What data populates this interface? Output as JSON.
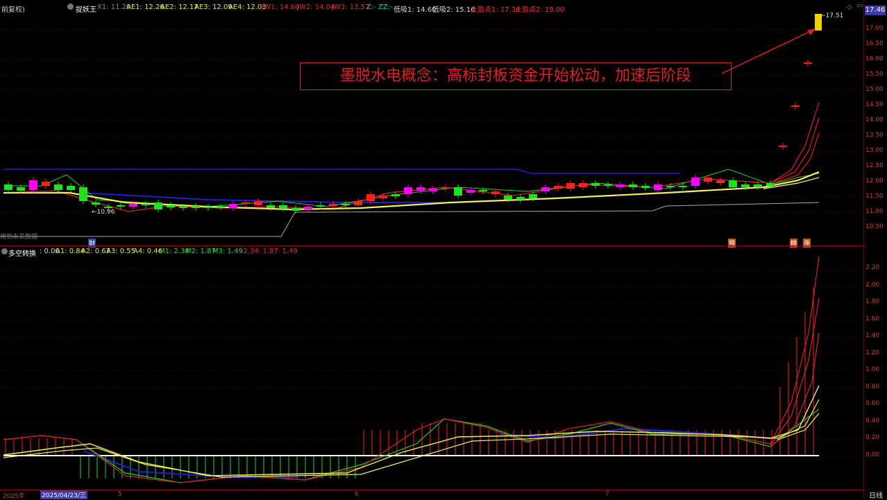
{
  "header": {
    "adjust_label": "前复权)",
    "indicator_name": "捉妖王",
    "x1": "X1: 11.29",
    "ae1": "AE1: 12.26",
    "ae2": "AE2: 12.17",
    "ae3": "AE3: 12.09",
    "ae4": "AE4: 12.03",
    "jw1": "JW1: 14.60",
    "jw2": "JW2: 14.04",
    "jw3": "JW3: 13.57",
    "zz": "Z:- ZZ:-",
    "dx1": "低吸1: 14.60",
    "dx2": "低吸2: 15.16",
    "zy1": "止盈点1: 17.34",
    "zy2": "止盈点2: 19.00"
  },
  "price_axis": {
    "last_price": "17.46",
    "ticks": [
      "17.00",
      "16.50",
      "16.00",
      "15.50",
      "15.00",
      "14.50",
      "14.00",
      "13.50",
      "13.00",
      "12.50",
      "12.00",
      "11.50",
      "11.00",
      "10.50"
    ]
  },
  "main": {
    "annotation": "墨脱水电概念：高标封板资金开始松动，加速后阶段",
    "high_label": "17.51",
    "low_label": "10.96",
    "future_data_label": "用到未来数据",
    "markers": {
      "cai": "财",
      "yu": "预",
      "jing": "精",
      "zhang": "涨"
    },
    "colors": {
      "up": "#ff2020",
      "down": "#20e020",
      "star": "#ff00ff",
      "blue": "#2020d0"
    }
  },
  "sub": {
    "name": "多空转换",
    "value": ": 0.00",
    "a1": "A1: 0.84",
    "a2": "A2: 0.67",
    "a3": "A3: 0.55",
    "a4": "A4: 0.46",
    "m1": "M1: 2.34",
    "m2": "M2: 1.87",
    "m3": "M3: 1.49",
    "r1": ": 2.34",
    "r2": ": 1.87",
    "r3": ": 1.49",
    "ticks": [
      "2.20",
      "2.00",
      "1.80",
      "1.60",
      "1.40",
      "1.20",
      "1.00",
      "0.80",
      "0.60",
      "0.40",
      "0.20",
      "0.00"
    ]
  },
  "xaxis": {
    "year": "2025年",
    "date": "2025/04/23/三",
    "m5": "5",
    "m6": "6",
    "m7": "7",
    "period": "日线"
  }
}
